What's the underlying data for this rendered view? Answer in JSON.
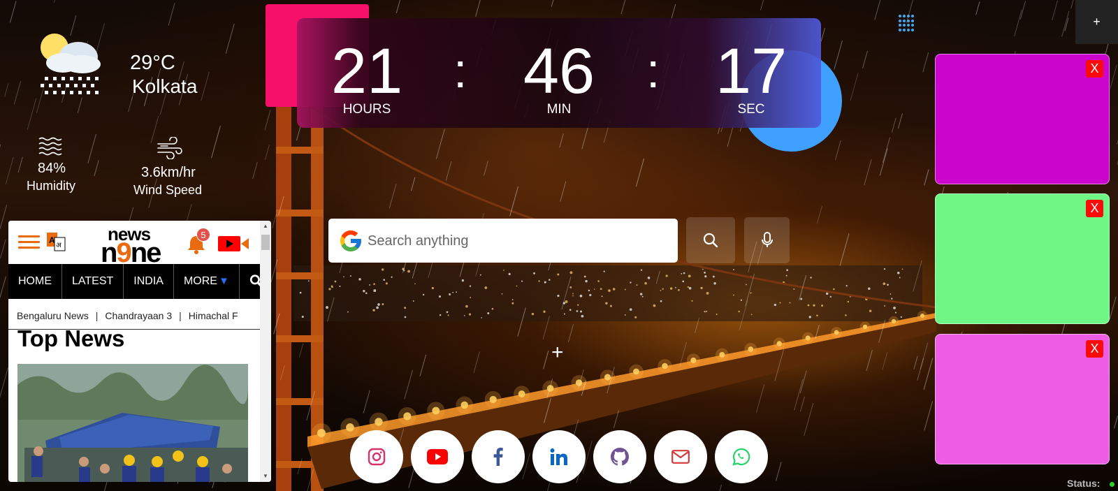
{
  "weather": {
    "temperature": "29°C",
    "city": "Kolkata",
    "humidity_value": "84%",
    "humidity_label": "Humidity",
    "wind_value": "3.6km/hr",
    "wind_label": "Wind Speed"
  },
  "clock": {
    "hours": "21",
    "minutes": "46",
    "seconds": "17",
    "separator": ":",
    "hours_label": "HOURS",
    "minutes_label": "MIN",
    "seconds_label": "SEC"
  },
  "controls": {
    "add_note_label": "+",
    "center_add_label": "+"
  },
  "sticky_notes": [
    {
      "color": "#cc05cc",
      "close_label": "X"
    },
    {
      "color": "#6ff786",
      "close_label": "X"
    },
    {
      "color": "#ee5ee4",
      "close_label": "X"
    }
  ],
  "news": {
    "logo_top": "news",
    "logo_bottom_a": "n",
    "logo_bottom_b": "9",
    "logo_bottom_c": "ne",
    "notification_count": "5",
    "nav": [
      "HOME",
      "LATEST",
      "INDIA",
      "MORE"
    ],
    "tags": [
      "Bengaluru News",
      "Chandrayaan 3",
      "Himachal F"
    ],
    "section_title": "Top News"
  },
  "search": {
    "placeholder": "Search anything"
  },
  "social": [
    "instagram-icon",
    "youtube-icon",
    "facebook-icon",
    "linkedin-icon",
    "github-icon",
    "mail-icon",
    "whatsapp-icon"
  ],
  "status": {
    "label": "Status:",
    "color": "#2bd42b"
  }
}
